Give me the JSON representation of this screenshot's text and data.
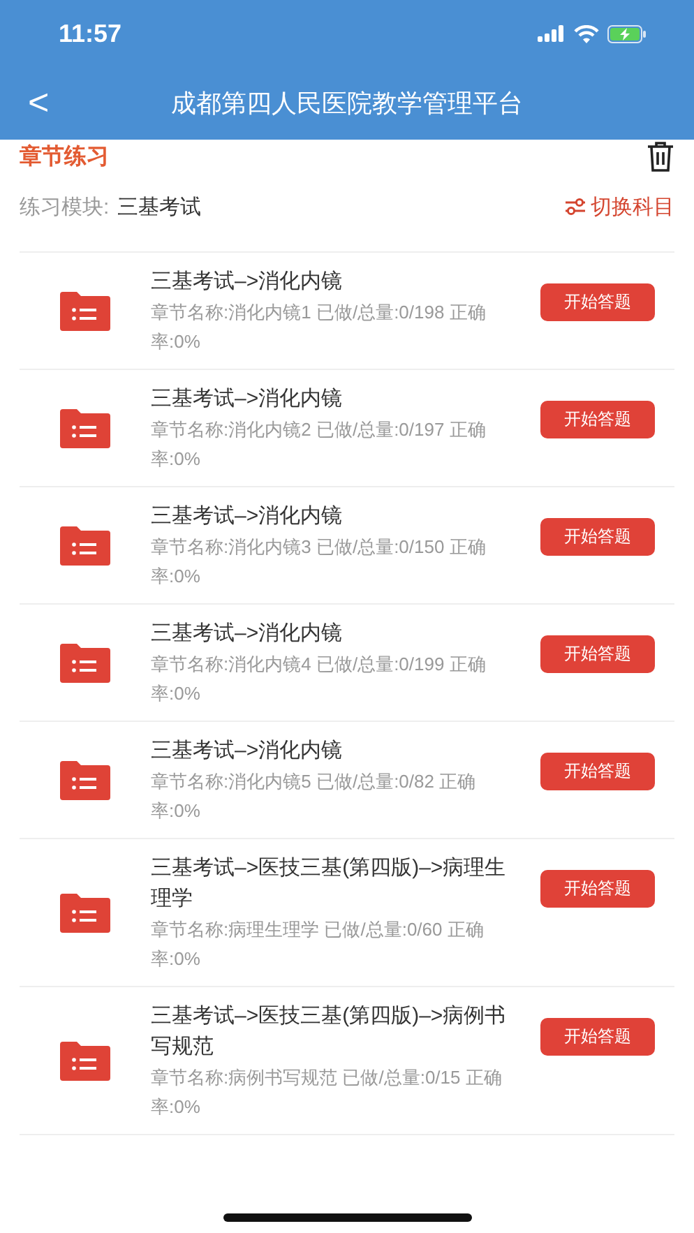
{
  "status_bar": {
    "time": "11:57"
  },
  "nav": {
    "back": "<",
    "title": "成都第四人民医院教学管理平台"
  },
  "section": {
    "title": "章节练习"
  },
  "module": {
    "label": "练习模块:",
    "value": "三基考试",
    "switch": "切换科目"
  },
  "chapters": [
    {
      "title": "三基考试–>消化内镜",
      "detail": "章节名称:消化内镜1 已做/总量:0/198 正确率:0%",
      "button": "开始答题"
    },
    {
      "title": "三基考试–>消化内镜",
      "detail": "章节名称:消化内镜2 已做/总量:0/197 正确率:0%",
      "button": "开始答题"
    },
    {
      "title": "三基考试–>消化内镜",
      "detail": "章节名称:消化内镜3 已做/总量:0/150 正确率:0%",
      "button": "开始答题"
    },
    {
      "title": "三基考试–>消化内镜",
      "detail": "章节名称:消化内镜4 已做/总量:0/199 正确率:0%",
      "button": "开始答题"
    },
    {
      "title": "三基考试–>消化内镜",
      "detail": "章节名称:消化内镜5 已做/总量:0/82 正确率:0%",
      "button": "开始答题"
    },
    {
      "title": "三基考试–>医技三基(第四版)–>病理生理学",
      "detail": "章节名称:病理生理学 已做/总量:0/60 正确率:0%",
      "button": "开始答题"
    },
    {
      "title": "三基考试–>医技三基(第四版)–>病例书写规范",
      "detail": "章节名称:病例书写规范 已做/总量:0/15 正确率:0%",
      "button": "开始答题"
    }
  ]
}
